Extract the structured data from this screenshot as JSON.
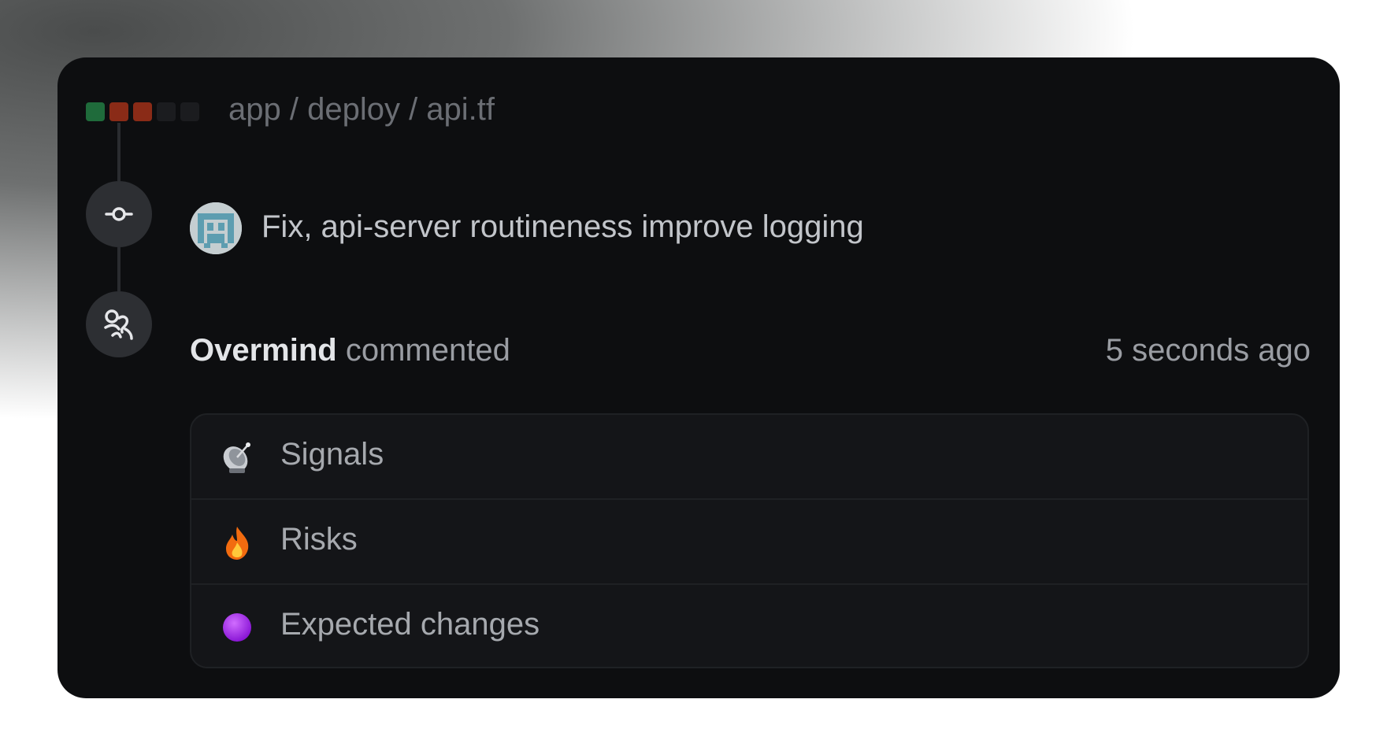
{
  "window": {
    "dots": [
      {
        "color": "#1f6b3b"
      },
      {
        "color": "#8a2b17"
      },
      {
        "color": "#8a2b17"
      },
      {
        "color": "#1b1c1f"
      },
      {
        "color": "#1b1c1f"
      }
    ],
    "breadcrumb": "app / deploy / api.tf"
  },
  "commit": {
    "icon": "git-commit-icon",
    "avatar": "pixel-avatar",
    "message": "Fix, api-server routineness improve logging"
  },
  "comment": {
    "icon": "overmind-logo-icon",
    "author": "Overmind",
    "action": "commented",
    "time": "5 seconds ago"
  },
  "sections": [
    {
      "icon": "satellite-dish-icon",
      "label": "Signals"
    },
    {
      "icon": "fire-icon",
      "label": "Risks"
    },
    {
      "icon": "purple-circle-icon",
      "label": "Expected changes"
    }
  ],
  "colors": {
    "card_bg": "#0d0e10",
    "panel_bg": "#141518",
    "node_bg": "#2d2f33",
    "accent_purple": "#a020e6",
    "fire_orange": "#f26b0f"
  }
}
